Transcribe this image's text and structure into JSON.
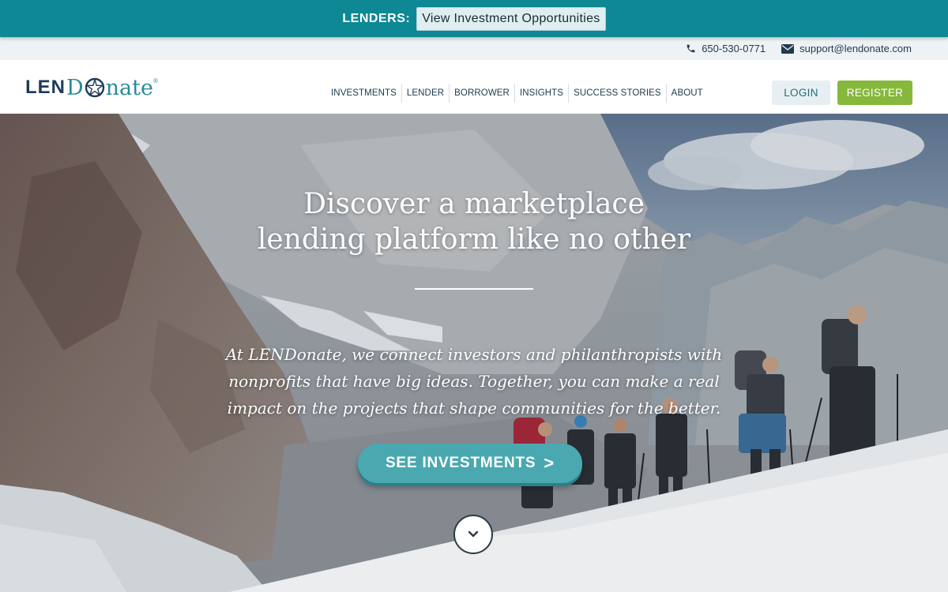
{
  "announcement": {
    "label": "LENDERS:",
    "button_label": "View Investment Opportunities"
  },
  "contact": {
    "phone": "650-530-0771",
    "email": "support@lendonate.com"
  },
  "logo": {
    "prefix": "LEN",
    "d": "D",
    "suffix": "nate",
    "reg": "®"
  },
  "nav": {
    "items": [
      "INVESTMENTS",
      "LENDER",
      "BORROWER",
      "INSIGHTS",
      "SUCCESS STORIES",
      "ABOUT"
    ]
  },
  "auth": {
    "login_label": "LOGIN",
    "register_label": "REGISTER"
  },
  "hero": {
    "title_line1": "Discover a marketplace",
    "title_line2": "lending platform like no other",
    "body": "At LENDonate, we connect investors and philanthropists with nonprofits that have big ideas. Together, you can make a real impact on the projects that shape communities for the better.",
    "cta_label": "SEE INVESTMENTS",
    "cta_arrow": ">"
  },
  "colors": {
    "brand_teal": "#0d8894",
    "cta_teal": "#4aa8b0",
    "register_green": "#86b83c",
    "logo_navy": "#1e3a5a"
  }
}
